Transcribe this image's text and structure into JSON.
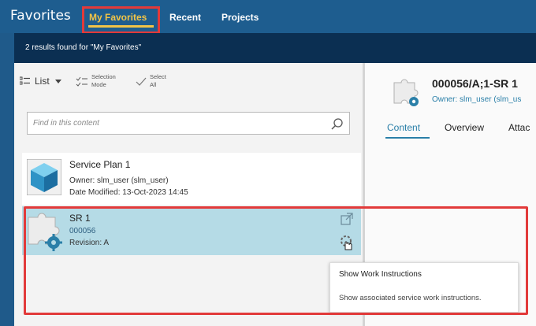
{
  "header": {
    "app_title": "Favorites",
    "tabs": [
      {
        "label": "My Favorites",
        "active": true
      },
      {
        "label": "Recent",
        "active": false
      },
      {
        "label": "Projects",
        "active": false
      }
    ]
  },
  "results_bar": {
    "text": "2 results found for \"My Favorites\""
  },
  "toolbar": {
    "list_label": "List",
    "selection_mode_label_1": "Selection",
    "selection_mode_label_2": "Mode",
    "select_all_label_1": "Select",
    "select_all_label_2": "All"
  },
  "search": {
    "placeholder": "Find in this content"
  },
  "items": [
    {
      "title": "Service Plan 1",
      "owner": "Owner:  slm_user (slm_user)",
      "date_modified": "Date Modified:  13-Oct-2023 14:45"
    },
    {
      "title": "SR 1",
      "id": "000056",
      "revision": "Revision:  A"
    }
  ],
  "tooltip": {
    "title": "Show Work Instructions",
    "description": "Show associated service work instructions."
  },
  "detail": {
    "title": "000056/A;1-SR 1",
    "owner": "Owner: slm_user (slm_us",
    "tabs": [
      "Content",
      "Overview",
      "Attac"
    ]
  },
  "colors": {
    "header_bg": "#1e5d8f",
    "results_bg": "#0b2f52",
    "active_tab": "#f2c447",
    "highlight": "#e23a3a",
    "selected_row": "#b5dbe6",
    "detail_accent": "#2a7fa8"
  },
  "icons": {
    "list": "list-icon",
    "dropdown": "chevron-down-icon",
    "selection_mode": "checklist-icon",
    "select_all": "checkmark-icon",
    "search": "search-icon",
    "service_plan": "cube-icon",
    "service_requirement": "puzzle-gear-icon",
    "open_in": "open-external-icon",
    "work_instructions": "settings-hand-icon"
  }
}
